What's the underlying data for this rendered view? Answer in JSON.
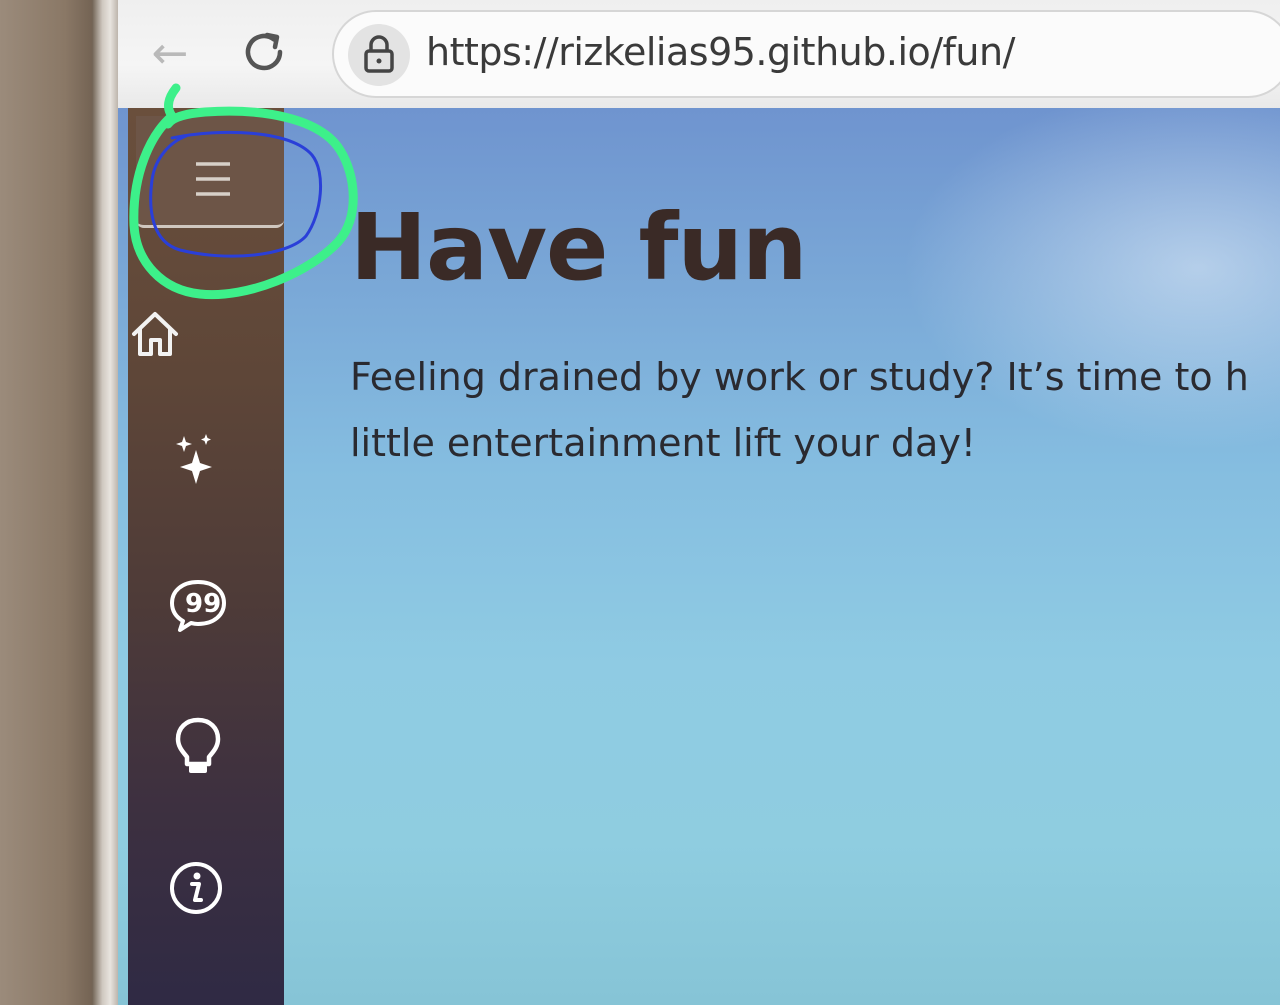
{
  "browser": {
    "url": "https://rizkelias95.github.io/fun/",
    "back_icon": "arrow-left-icon",
    "reload_icon": "reload-icon",
    "lock_icon": "lock-icon"
  },
  "sidebar": {
    "items": [
      {
        "icon": "hamburger-menu-icon"
      },
      {
        "icon": "home-icon"
      },
      {
        "icon": "sparkles-icon"
      },
      {
        "icon": "quote-chat-icon"
      },
      {
        "icon": "lightbulb-icon"
      },
      {
        "icon": "info-icon"
      }
    ]
  },
  "main": {
    "title": "Have fun",
    "description_line1": "Feeling drained by work or study? It’s time to h",
    "description_line2": "little entertainment lift your day!"
  },
  "annotation": {
    "outer_color": "#3df08a",
    "inner_color": "#2a3fd8"
  }
}
